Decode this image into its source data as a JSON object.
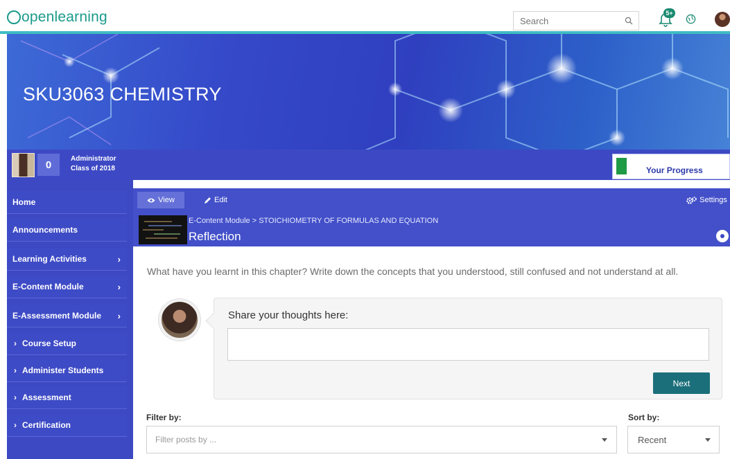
{
  "app": {
    "logo_text": "openlearning"
  },
  "topbar": {
    "search_placeholder": "Search",
    "notification_count": "5+"
  },
  "banner": {
    "title": "SKU3063 CHEMISTRY"
  },
  "user": {
    "points": "0",
    "name": "Administrator",
    "class": "Class of 2018",
    "progress_label": "Your Progress"
  },
  "sidebar": {
    "items": [
      {
        "label": "Home"
      },
      {
        "label": "Announcements"
      },
      {
        "label": "Learning Activities",
        "chevron": "›"
      },
      {
        "label": "E-Content Module",
        "chevron": "›"
      },
      {
        "label": "E-Assessment Module",
        "chevron": "›"
      },
      {
        "label": "Course Setup",
        "lead": "›"
      },
      {
        "label": "Administer Students",
        "lead": "›"
      },
      {
        "label": "Assessment",
        "lead": "›"
      },
      {
        "label": "Certification",
        "lead": "›"
      }
    ]
  },
  "tabs": {
    "view": "View",
    "edit": "Edit",
    "settings": "Settings"
  },
  "module": {
    "breadcrumb": "E-Content Module > STOICHIOMETRY OF FORMULAS AND EQUATION",
    "title": "Reflection"
  },
  "content": {
    "prompt": "What have you learnt in this chapter? Write down the concepts that you understood, still confused and not understand at all.",
    "share_label": "Share your thoughts here:",
    "next_label": "Next",
    "filter_label": "Filter by:",
    "filter_placeholder": "Filter posts by ...",
    "sort_label": "Sort by:",
    "sort_value": "Recent"
  },
  "colors": {
    "brand_teal": "#1a9a8a",
    "nav_blue": "#3c49c2",
    "button_teal": "#1b6f7a",
    "progress_green": "#1f9a45"
  },
  "icons": [
    "search-icon",
    "bell-icon",
    "globe-icon",
    "eye-icon",
    "pencil-icon",
    "gears-icon",
    "chevron-right-icon",
    "caret-down-icon"
  ]
}
